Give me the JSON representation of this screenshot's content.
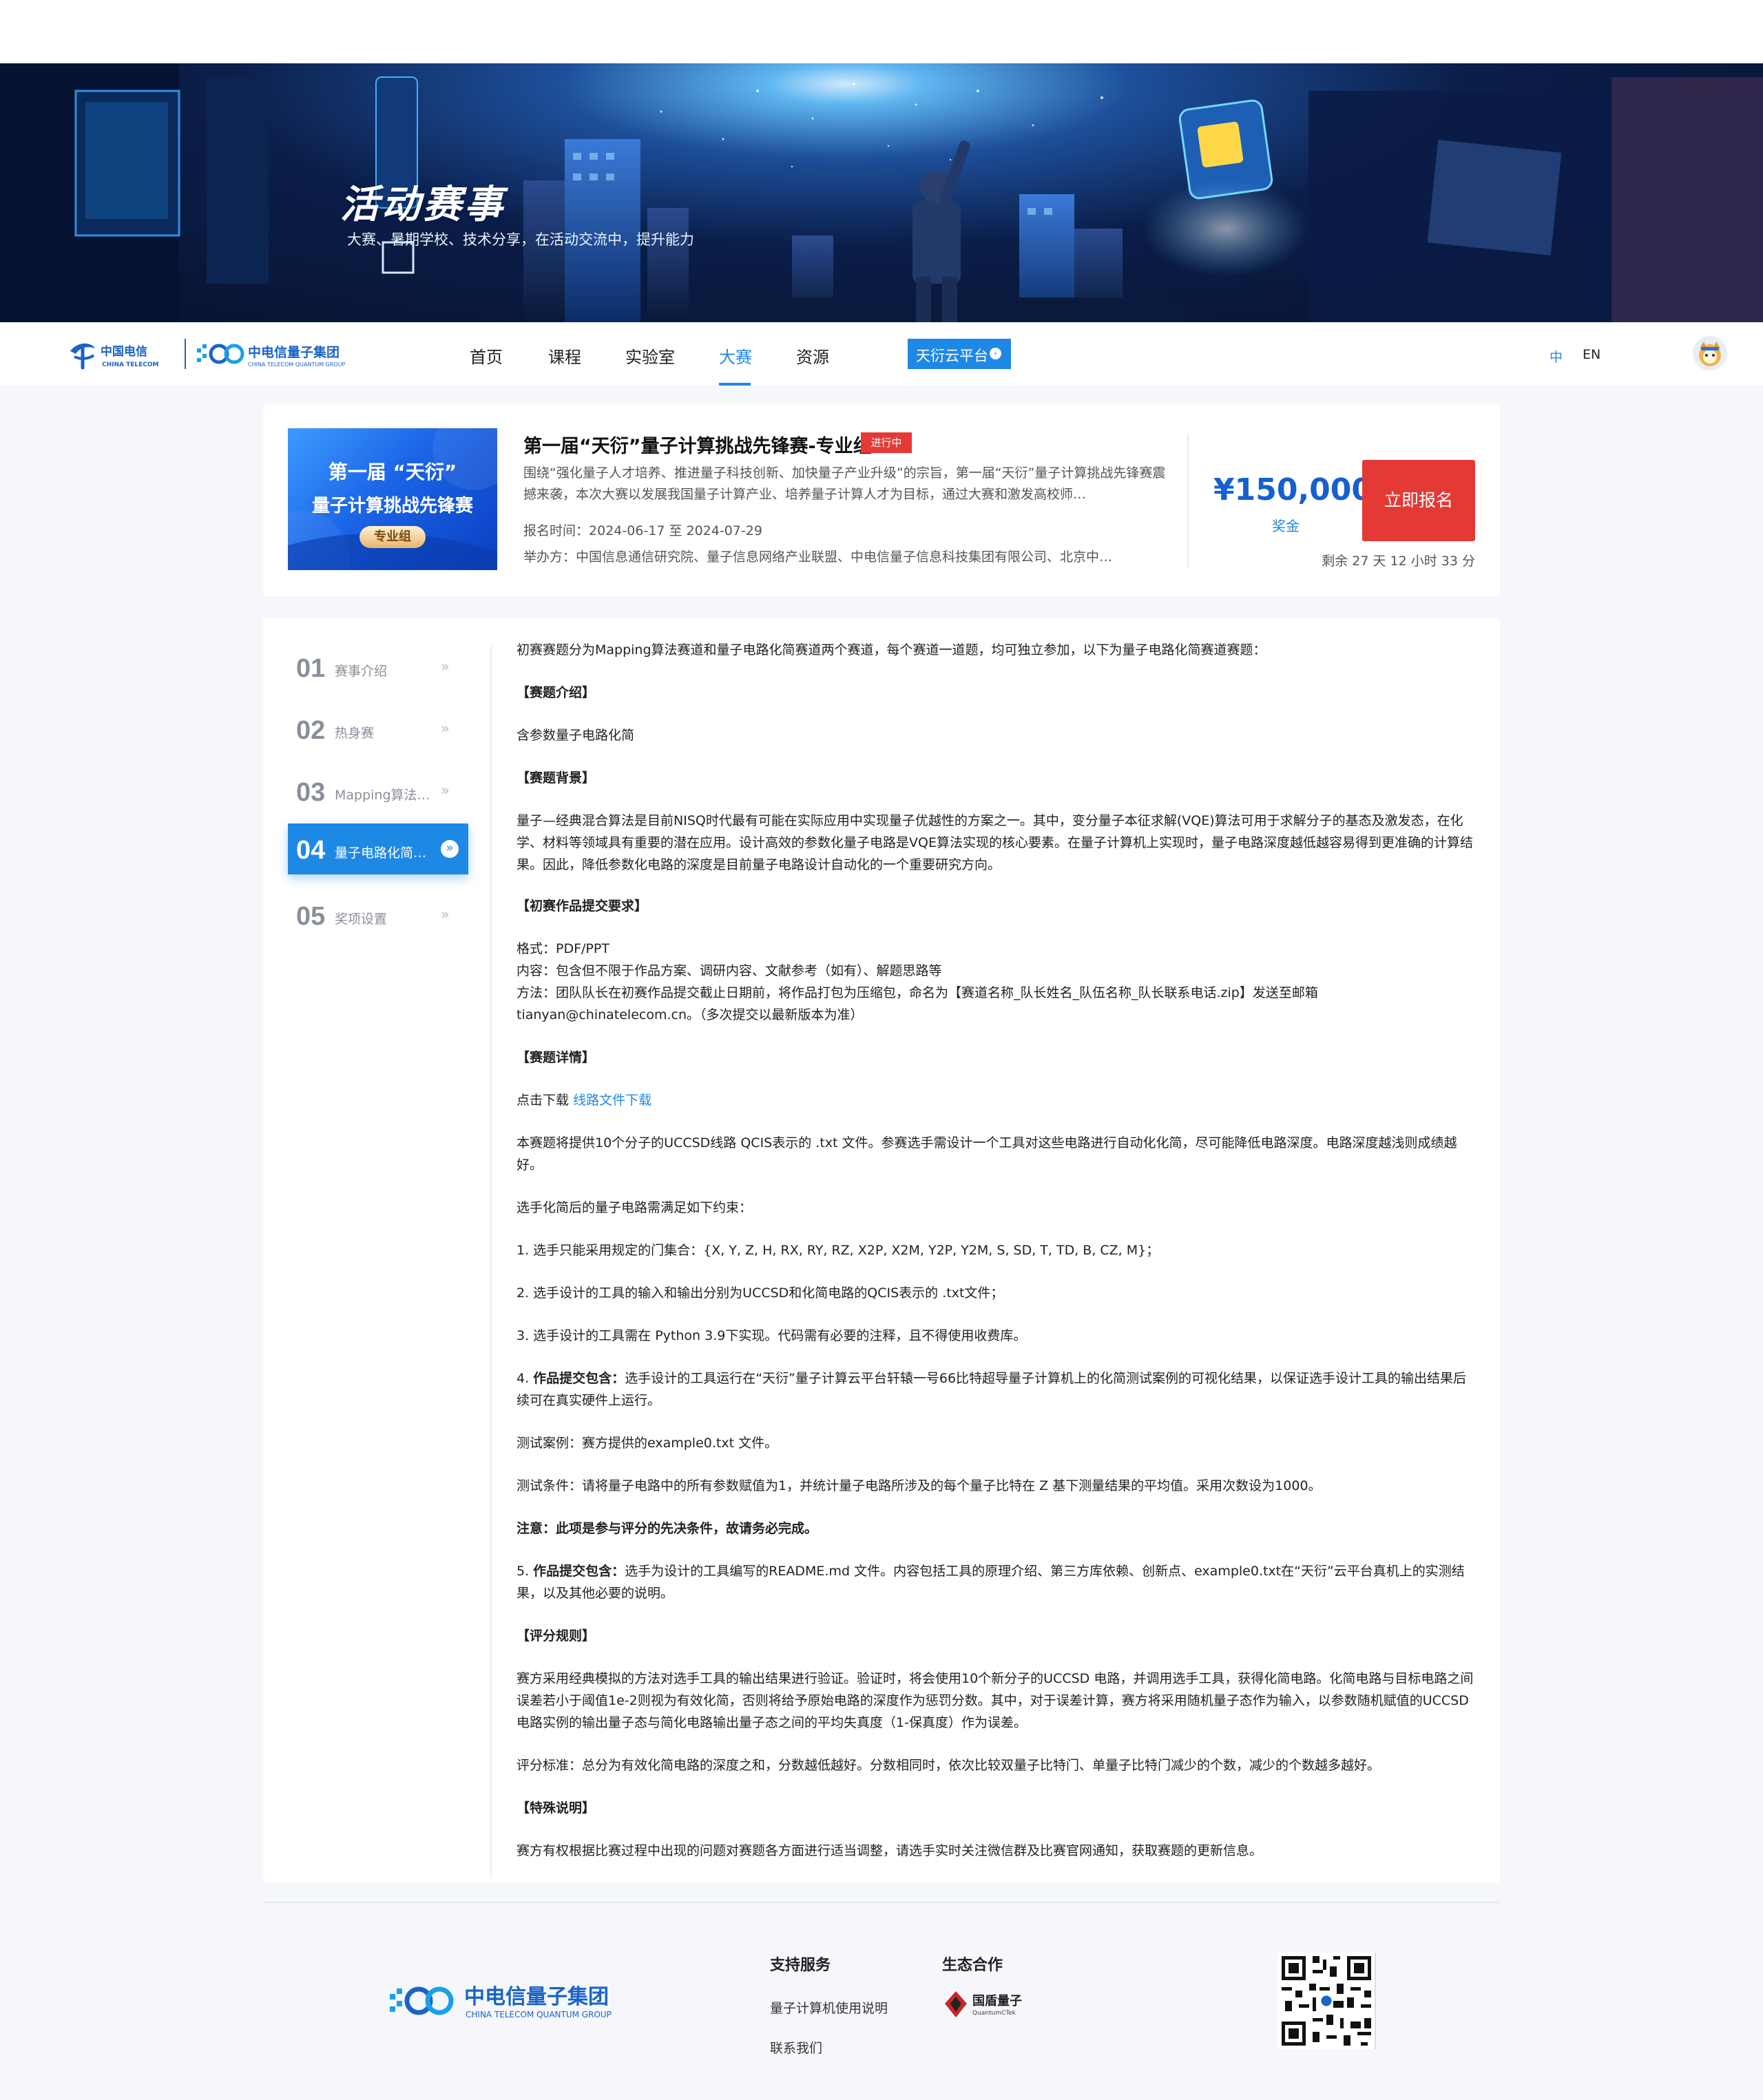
{
  "banner": {
    "title": "活动赛事",
    "subtitle": "大赛、暑期学校、技术分享，在活动交流中，提升能力"
  },
  "nav": {
    "brand_ct": "中国电信",
    "brand_ct_en": "CHINA TELECOM",
    "brand_qg": "中电信量子集团",
    "brand_qg_en": "CHINA TELECOM QUANTUM GROUP",
    "items": [
      "首页",
      "课程",
      "实验室",
      "大赛",
      "资源"
    ],
    "active_index": 3,
    "cloud_label": "天衍云平台",
    "lang_zh": "中",
    "lang_en": "EN",
    "accent": "#1e88e5"
  },
  "competition": {
    "poster_line1": "第一届 “天衍”",
    "poster_line2": "量子计算挑战先锋赛",
    "poster_tag": "专业组",
    "title": "第一届“天衍”量子计算挑战先锋赛-专业组",
    "status": "进行中",
    "description": "围绕“强化量子人才培养、推进量子科技创新、加快量子产业升级”的宗旨，第一届“天衍”量子计算挑战先锋赛震撼来袭，本次大赛以发展我国量子计算产业、培养量子计算人才为目标，通过大赛和激发高校师…",
    "date_label": "报名时间：",
    "date_value": "2024-06-17 至 2024-07-29",
    "organizer_label": "举办方：",
    "organizer_value": "中国信息通信研究院、量子信息网络产业联盟、中电信量子信息科技集团有限公司、北京中…",
    "prize": "¥150,000",
    "prize_label": "奖金",
    "signup_label": "立即报名",
    "countdown": "剩余 27 天 12 小时 33 分",
    "danger_color": "#e53935"
  },
  "sidebar": [
    {
      "num": "01",
      "label": "赛事介绍"
    },
    {
      "num": "02",
      "label": "热身赛"
    },
    {
      "num": "03",
      "label": "Mapping算法…"
    },
    {
      "num": "04",
      "label": "量子电路化简…"
    },
    {
      "num": "05",
      "label": "奖项设置"
    }
  ],
  "sidebar_active": 3,
  "content": {
    "intro": "初赛赛题分为Mapping算法赛道和量子电路化简赛道两个赛道，每个赛道一道题，均可独立参加，以下为量子电路化简赛道赛题：",
    "h_intro": "【赛题介绍】",
    "topic": "含参数量子电路化简",
    "h_background": "【赛题背景】",
    "background": "量子—经典混合算法是目前NISQ时代最有可能在实际应用中实现量子优越性的方案之一。其中，变分量子本征求解(VQE)算法可用于求解分子的基态及激发态，在化学、材料等领域具有重要的潜在应用。设计高效的参数化量子电路是VQE算法实现的核心要素。在量子计算机上实现时，量子电路深度越低越容易得到更准确的计算结果。因此，降低参数化电路的深度是目前量子电路设计自动化的一个重要研究方向。",
    "h_submit": "【初赛作品提交要求】",
    "format": "格式：PDF/PPT",
    "scope": "内容：包含但不限于作品方案、调研内容、文献参考（如有）、解题思路等",
    "method": "方法：团队队长在初赛作品提交截止日期前，将作品打包为压缩包，命名为【赛道名称_队长姓名_队伍名称_队长联系电话.zip】发送至邮箱tianyan@chinatelecom.cn。（多次提交以最新版本为准）",
    "h_detail": "【赛题详情】",
    "download_prefix": "点击下载",
    "download_link": "线路文件下载",
    "detail1": "本赛题将提供10个分子的UCCSD线路 QCIS表示的 .txt 文件。参赛选手需设计一个工具对这些电路进行自动化化简，尽可能降低电路深度。电路深度越浅则成绩越好。",
    "detail2": "选手化简后的量子电路需满足如下约束：",
    "rule1": "1. 选手只能采用规定的门集合：{X, Y, Z, H, RX, RY, RZ, X2P, X2M, Y2P, Y2M, S, SD, T, TD, B, CZ, M}；",
    "rule2": "2. 选手设计的工具的输入和输出分别为UCCSD和化简电路的QCIS表示的 .txt文件；",
    "rule3": "3. 选手设计的工具需在 Python 3.9下实现。代码需有必要的注释，且不得使用收费库。",
    "rule4_prefix": "4. ",
    "rule4_bold": "作品提交包含：",
    "rule4_text": "选手设计的工具运行在“天衍”量子计算云平台轩辕一号66比特超导量子计算机上的化简测试案例的可视化结果，以保证选手设计工具的输出结果后续可在真实硬件上运行。",
    "test_case": "测试案例：赛方提供的example0.txt 文件。",
    "test_cond": "测试条件：请将量子电路中的所有参数赋值为1，并统计量子电路所涉及的每个量子比特在 Z 基下测量结果的平均值。采用次数设为1000。",
    "note": "注意：此项是参与评分的先决条件，故请务必完成。",
    "rule5_prefix": "5. ",
    "rule5_bold": "作品提交包含：",
    "rule5_text": "选手为设计的工具编写的README.md 文件。内容包括工具的原理介绍、第三方库依赖、创新点、example0.txt在“天衍”云平台真机上的实测结果，以及其他必要的说明。",
    "h_scoring": "【评分规则】",
    "scoring1": "赛方采用经典模拟的方法对选手工具的输出结果进行验证。验证时，将会使用10个新分子的UCCSD 电路，并调用选手工具，获得化简电路。化简电路与目标电路之间误差若小于阈值1e-2则视为有效化简，否则将给予原始电路的深度作为惩罚分数。其中，对于误差计算，赛方将采用随机量子态作为输入，以参数随机赋值的UCCSD电路实例的输出量子态与简化电路输出量子态之间的平均失真度（1-保真度）作为误差。",
    "scoring2": "评分标准：总分为有效化简电路的深度之和，分数越低越好。分数相同时，依次比较双量子比特门、单量子比特门减少的个数，减少的个数越多越好。",
    "h_special": "【特殊说明】",
    "special": "赛方有权根据比赛过程中出现的问题对赛题各方面进行适当调整，请选手实时关注微信群及比赛官网通知，获取赛题的更新信息。"
  },
  "footer": {
    "logo_cn": "中电信量子集团",
    "logo_en": "CHINA TELECOM QUANTUM GROUP",
    "support_title": "支持服务",
    "support_links": [
      "量子计算机使用说明",
      "联系我们"
    ],
    "eco_title": "生态合作",
    "partner_name": "国盾量子",
    "partner_en": "QuantumCTek"
  }
}
